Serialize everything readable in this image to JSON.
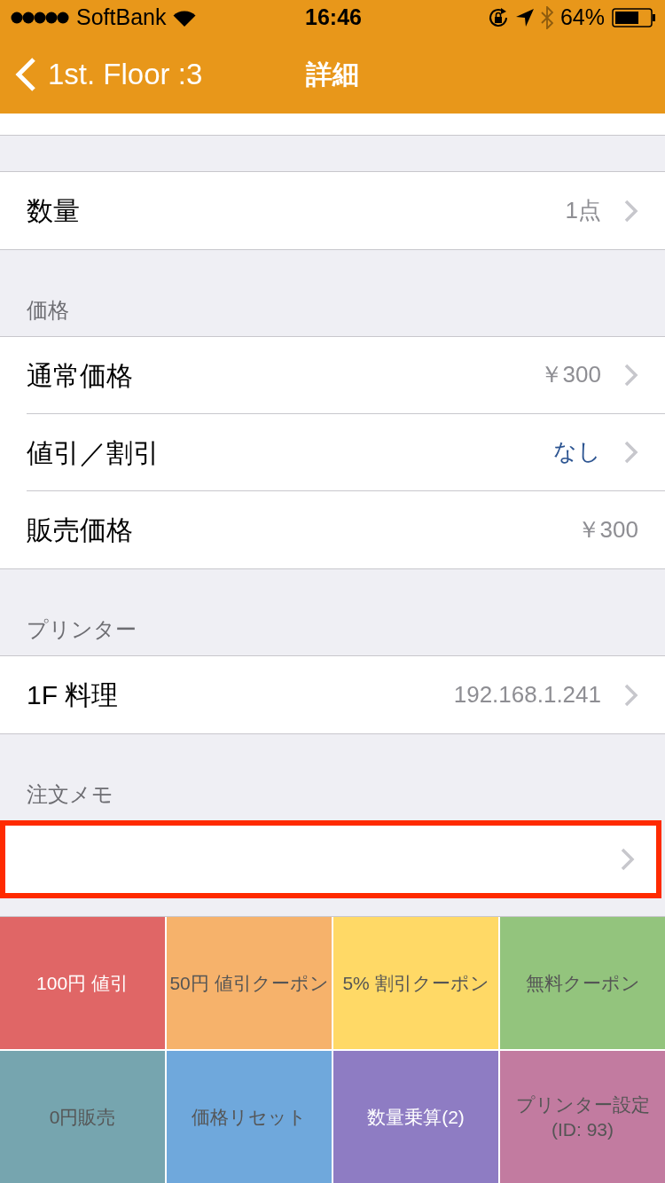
{
  "status_bar": {
    "carrier": "SoftBank",
    "time": "16:46",
    "battery": "64%",
    "bluetooth_connected": false
  },
  "nav_bar": {
    "back": "1st. Floor :3",
    "title": "詳細"
  },
  "sections": [
    {
      "rows": [
        {
          "label": "数量",
          "value": "1点",
          "accent": false,
          "disclosure": true
        }
      ]
    },
    {
      "header": "価格",
      "rows": [
        {
          "label": "通常価格",
          "value": "￥300",
          "accent": false,
          "disclosure": true
        },
        {
          "label": "値引／割引",
          "value": "なし",
          "accent": true,
          "disclosure": true
        },
        {
          "label": "販売価格",
          "value": "￥300",
          "accent": false,
          "disclosure": false
        }
      ]
    },
    {
      "header": "プリンター",
      "rows": [
        {
          "label": "1F 料理",
          "value": "192.168.1.241",
          "accent": false,
          "disclosure": true
        }
      ]
    }
  ],
  "memo": {
    "header": "注文メモ",
    "highlighted": true,
    "disclosure": true
  },
  "actions": [
    {
      "label": "100円 値引",
      "color": "#e06666",
      "light_text": true
    },
    {
      "label": "50円 値引クーポン",
      "color": "#f6b26b",
      "light_text": false
    },
    {
      "label": "5% 割引クーポン",
      "color": "#ffd966",
      "light_text": false
    },
    {
      "label": "無料クーポン",
      "color": "#93c47d",
      "light_text": false
    },
    {
      "label": "0円販売",
      "color": "#76a5af",
      "light_text": false
    },
    {
      "label": "価格リセット",
      "color": "#6fa8dc",
      "light_text": false
    },
    {
      "label": "数量乗算(2)",
      "color": "#8e7cc3",
      "light_text": true
    },
    {
      "label": "プリンター設定(ID: 93)",
      "color": "#c27ba0",
      "light_text": false
    }
  ]
}
